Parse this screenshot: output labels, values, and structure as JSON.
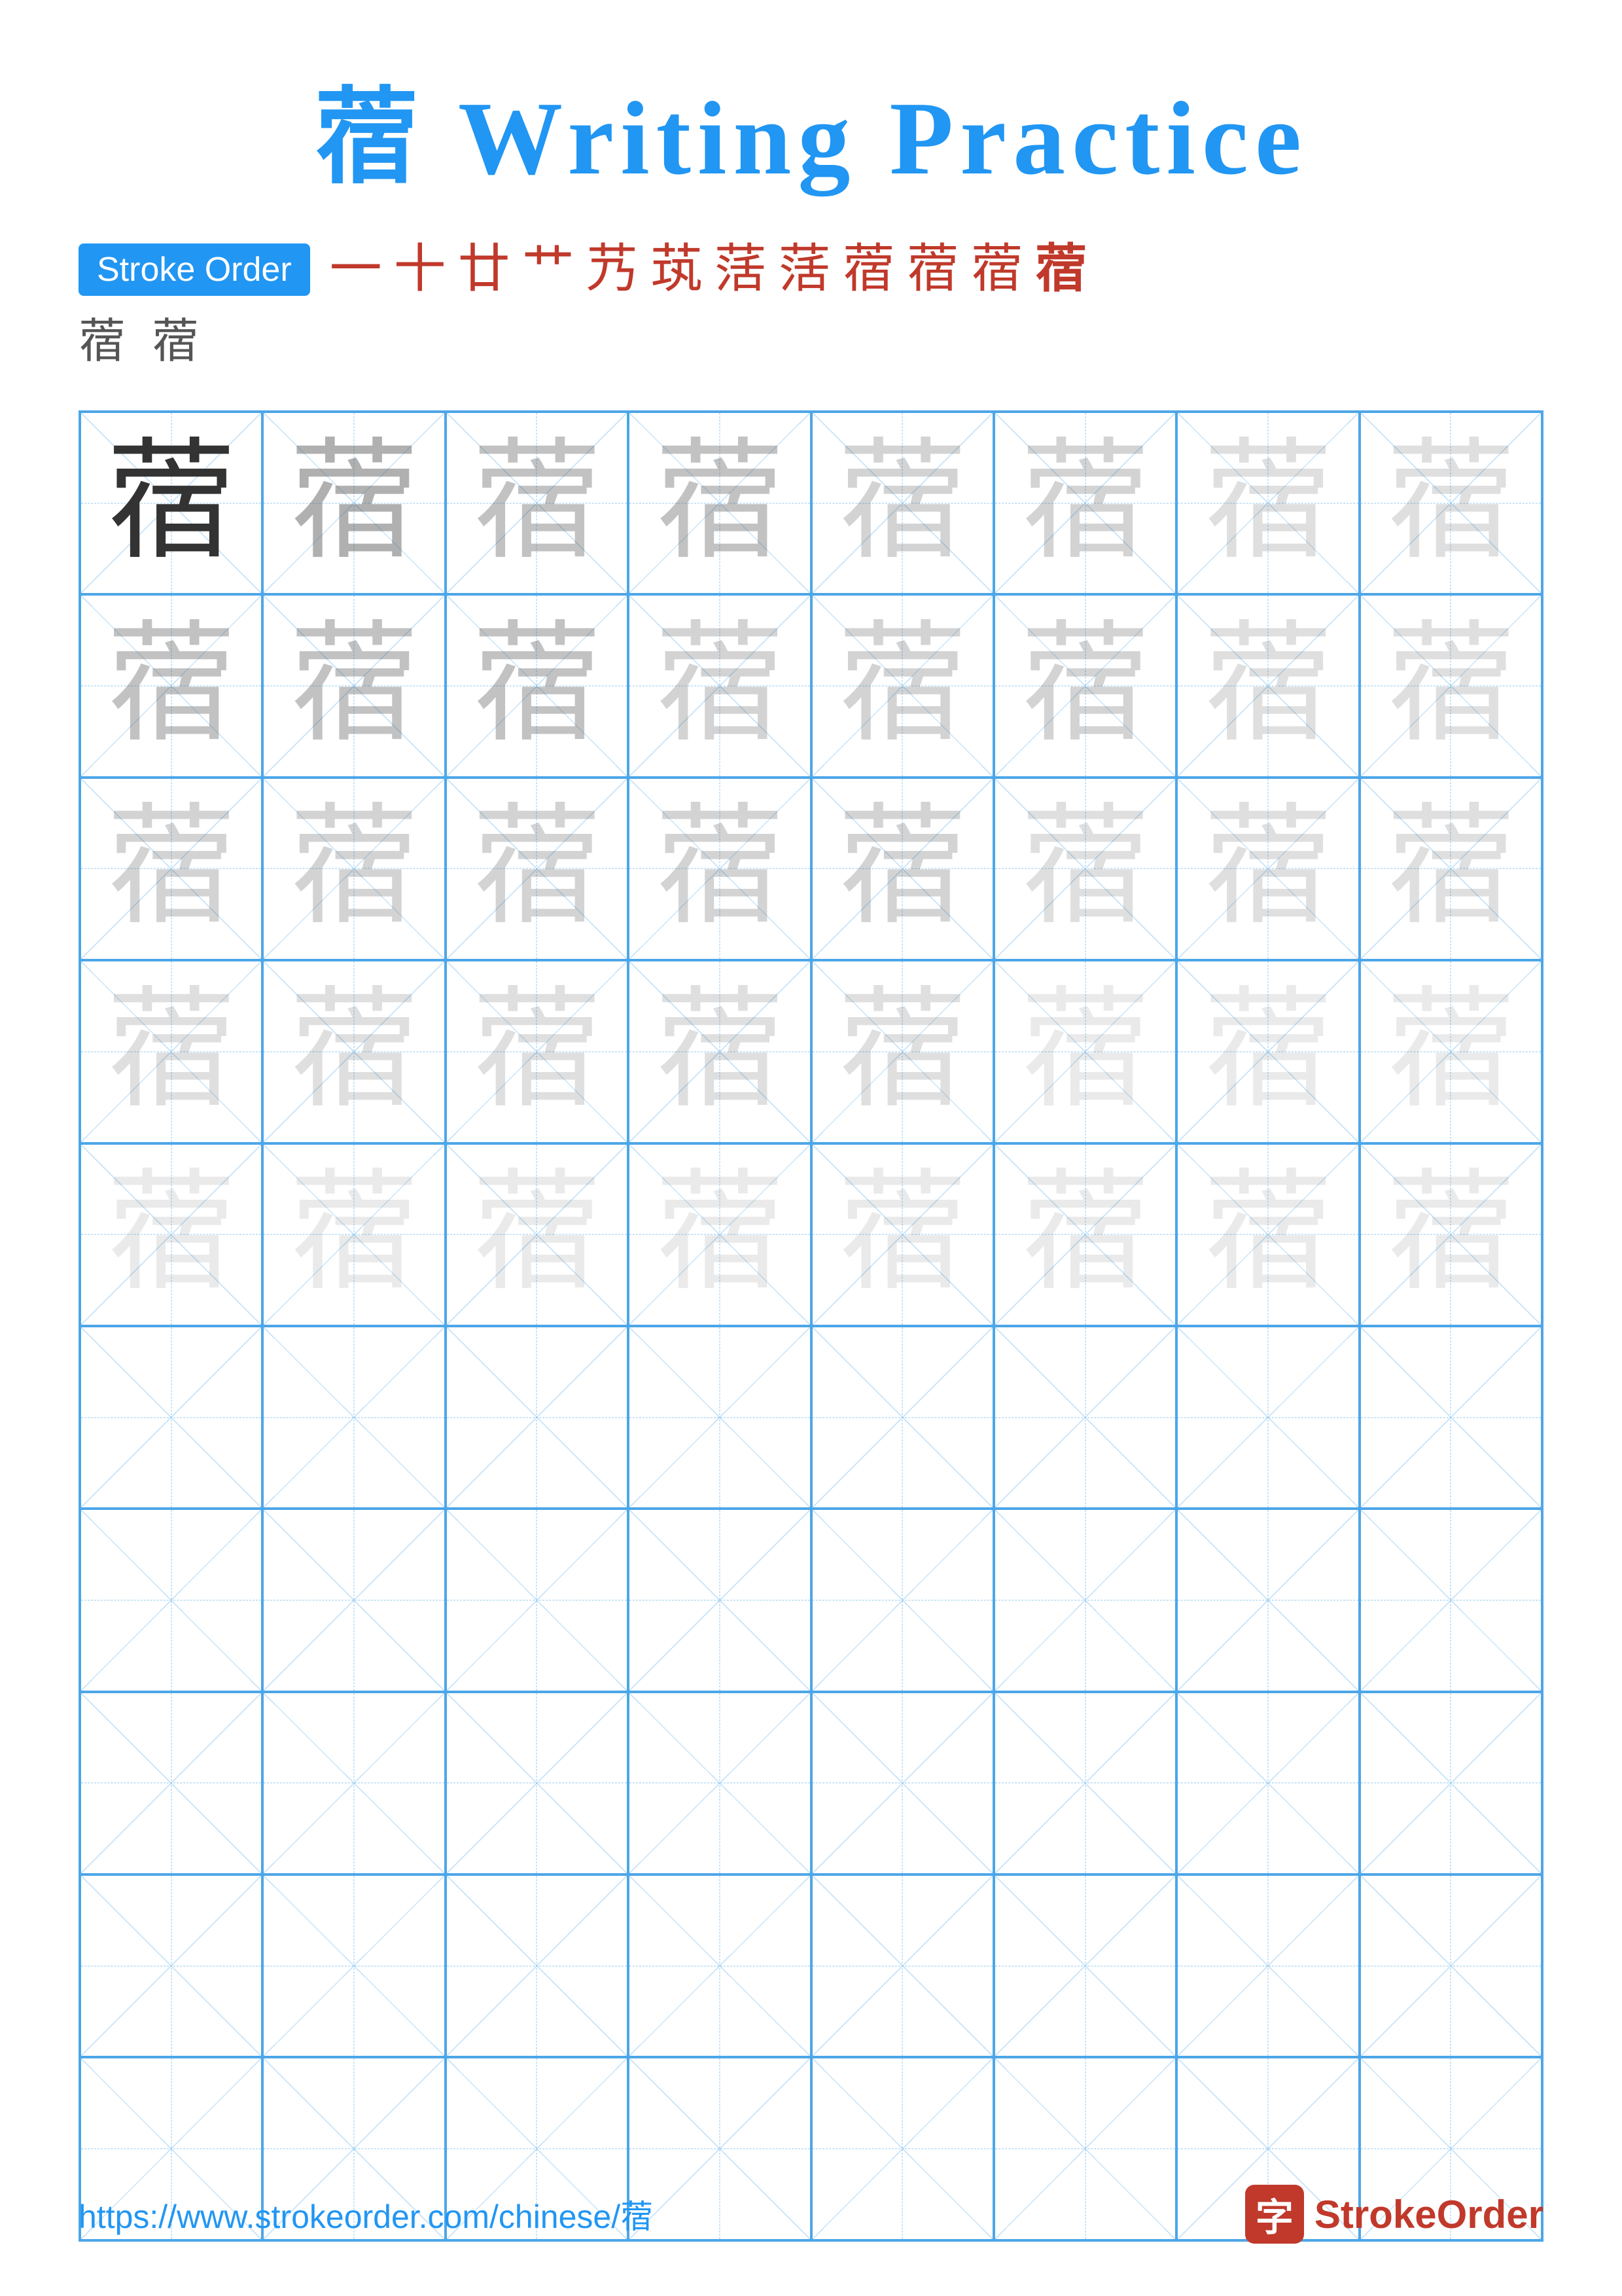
{
  "title": {
    "char": "蓿",
    "suffix": " Writing Practice",
    "full": "蓿 Writing Practice"
  },
  "stroke_order": {
    "badge_label": "Stroke Order",
    "sequence": [
      "一",
      "十",
      "廿",
      "艹",
      "艹",
      "茿",
      "萿",
      "萿",
      "蓿",
      "蓿",
      "蓿",
      "蓿"
    ],
    "pinyin_chars": [
      "蓿",
      "蓿"
    ]
  },
  "grid": {
    "rows": 10,
    "cols": 8,
    "char": "蓿",
    "practice_rows": 5,
    "empty_rows": 5
  },
  "footer": {
    "url": "https://www.strokeorder.com/chinese/蓿",
    "brand_char": "字",
    "brand_name": "StrokeOrder"
  },
  "colors": {
    "blue": "#2196F3",
    "red": "#c0392b",
    "grid_blue": "#4da6e8",
    "guide_blue": "#90c8f0"
  }
}
